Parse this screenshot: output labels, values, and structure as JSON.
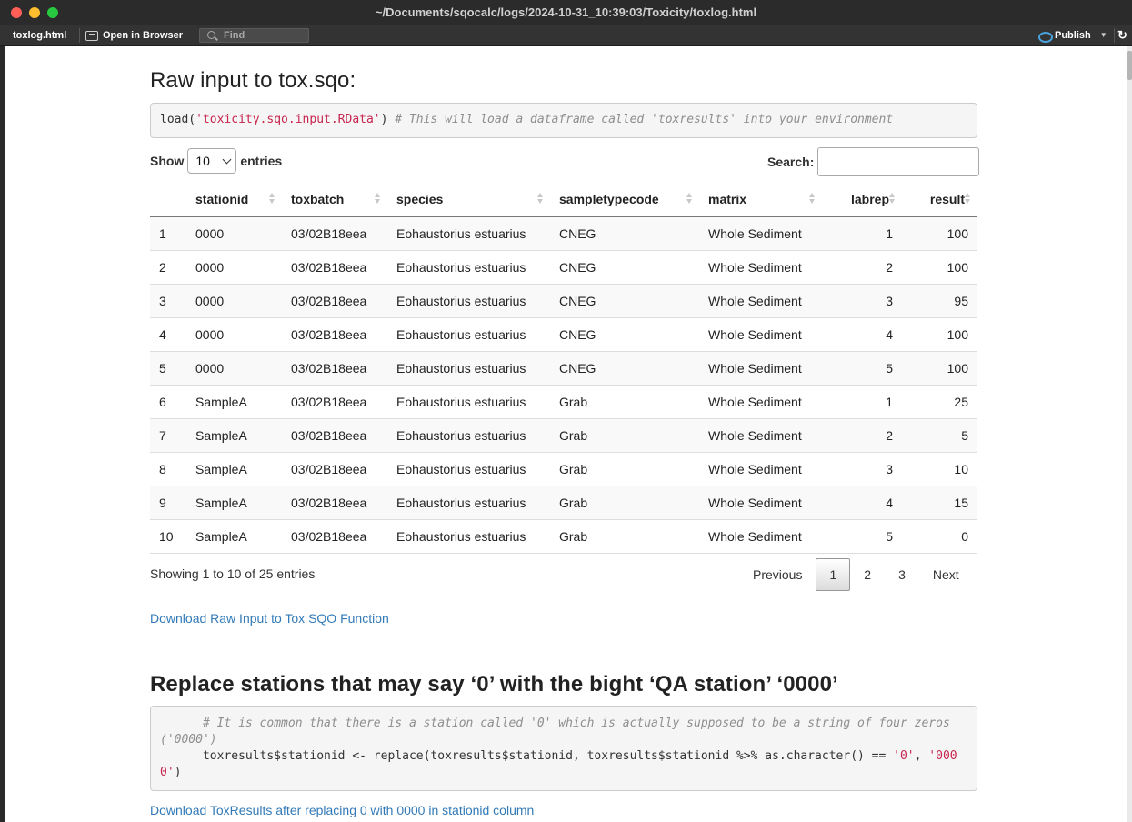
{
  "window": {
    "title": "~/Documents/sqocalc/logs/2024-10-31_10:39:03/Toxicity/toxlog.html"
  },
  "toolbar": {
    "file_tab": "toxlog.html",
    "open_in_browser": "Open in Browser",
    "find_placeholder": "Find",
    "publish": "Publish"
  },
  "section1": {
    "title": "Raw input to tox.sqo:",
    "code_prefix": "load(",
    "code_string": "'toxicity.sqo.input.RData'",
    "code_suffix": ") ",
    "code_comment": "# This will load a dataframe called 'toxresults' into your environment"
  },
  "datatable": {
    "show_label": "Show",
    "length_value": "10",
    "entries_label": "entries",
    "search_label": "Search:",
    "columns": [
      "",
      "stationid",
      "toxbatch",
      "species",
      "sampletypecode",
      "matrix",
      "labrep",
      "result"
    ],
    "rows": [
      [
        "1",
        "0000",
        "03/02B18eea",
        "Eohaustorius estuarius",
        "CNEG",
        "Whole Sediment",
        "1",
        "100"
      ],
      [
        "2",
        "0000",
        "03/02B18eea",
        "Eohaustorius estuarius",
        "CNEG",
        "Whole Sediment",
        "2",
        "100"
      ],
      [
        "3",
        "0000",
        "03/02B18eea",
        "Eohaustorius estuarius",
        "CNEG",
        "Whole Sediment",
        "3",
        "95"
      ],
      [
        "4",
        "0000",
        "03/02B18eea",
        "Eohaustorius estuarius",
        "CNEG",
        "Whole Sediment",
        "4",
        "100"
      ],
      [
        "5",
        "0000",
        "03/02B18eea",
        "Eohaustorius estuarius",
        "CNEG",
        "Whole Sediment",
        "5",
        "100"
      ],
      [
        "6",
        "SampleA",
        "03/02B18eea",
        "Eohaustorius estuarius",
        "Grab",
        "Whole Sediment",
        "1",
        "25"
      ],
      [
        "7",
        "SampleA",
        "03/02B18eea",
        "Eohaustorius estuarius",
        "Grab",
        "Whole Sediment",
        "2",
        "5"
      ],
      [
        "8",
        "SampleA",
        "03/02B18eea",
        "Eohaustorius estuarius",
        "Grab",
        "Whole Sediment",
        "3",
        "10"
      ],
      [
        "9",
        "SampleA",
        "03/02B18eea",
        "Eohaustorius estuarius",
        "Grab",
        "Whole Sediment",
        "4",
        "15"
      ],
      [
        "10",
        "SampleA",
        "03/02B18eea",
        "Eohaustorius estuarius",
        "Grab",
        "Whole Sediment",
        "5",
        "0"
      ]
    ],
    "info": "Showing 1 to 10 of 25 entries",
    "paging": {
      "previous": "Previous",
      "pages": [
        "1",
        "2",
        "3"
      ],
      "current": "1",
      "next": "Next"
    }
  },
  "download1": "Download Raw Input to Tox SQO Function",
  "section2": {
    "title": "Replace stations that may say ‘0’ with the bight ‘QA station’ ‘0000’",
    "comment_line": "# It is common that there is a station called '0' which is actually supposed to be a string of four zeros",
    "comment_line2": "('0000')",
    "code_line": "toxresults$stationid <- replace(toxresults$stationid, toxresults$stationid %>% as.character() == ",
    "code_str1": "'0'",
    "code_sep": ", ",
    "code_str2a": "'000",
    "code_str2b": "0'",
    "code_end": ")"
  },
  "download2": "Download ToxResults after replacing 0 with 0000 in stationid column"
}
